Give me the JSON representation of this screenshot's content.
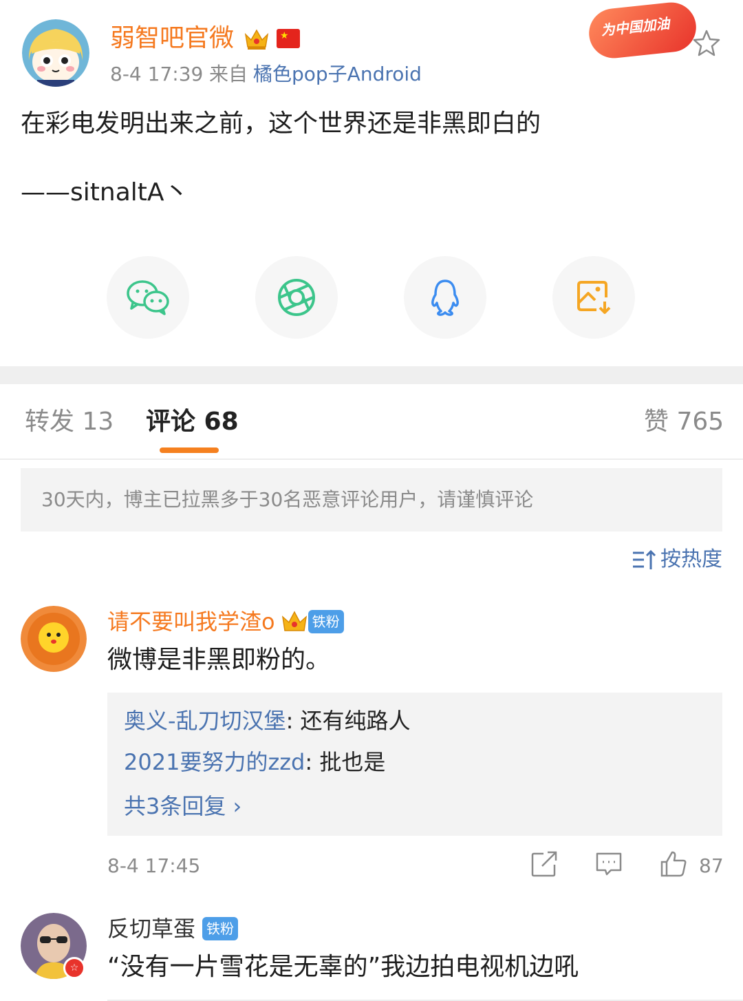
{
  "post": {
    "author": "弱智吧官微",
    "time": "8-4 17:39",
    "from_label": "来自",
    "source": "橘色pop子Android",
    "badge_text": "为中国加油",
    "text": "在彩电发明出来之前，这个世界还是非黑即白的",
    "signature": "——sitnaltA丶"
  },
  "share": {
    "items": [
      {
        "icon": "wechat-icon",
        "color": "#3cc58b"
      },
      {
        "icon": "moments-icon",
        "color": "#3cc58b"
      },
      {
        "icon": "qq-icon",
        "color": "#3b8cf0"
      },
      {
        "icon": "save-image-icon",
        "color": "#f5a623"
      }
    ]
  },
  "tabs": {
    "repost": "转发 13",
    "comment": "评论 68",
    "like": "赞 765"
  },
  "notice": "30天内，博主已拉黑多于30名恶意评论用户，请谨慎评论",
  "sort_label": "按热度",
  "comments": [
    {
      "user": "请不要叫我学渣o",
      "badge": "铁粉",
      "text": "微博是非黑即粉的。",
      "replies": [
        {
          "user": "奥义-乱刀切汉堡",
          "text": ": 还有纯路人"
        },
        {
          "user": "2021要努力的zzd",
          "text": ": 批也是"
        }
      ],
      "more_replies": "共3条回复 ›",
      "time": "8-4 17:45",
      "likes": "87"
    },
    {
      "user": "反切草蛋",
      "badge": "铁粉",
      "text": "“没有一片雪花是无辜的”我边拍电视机边吼"
    }
  ],
  "colors": {
    "brand_orange": "#f5791f",
    "link_blue": "#4a73b0",
    "fan_badge": "#4d9ee8"
  }
}
